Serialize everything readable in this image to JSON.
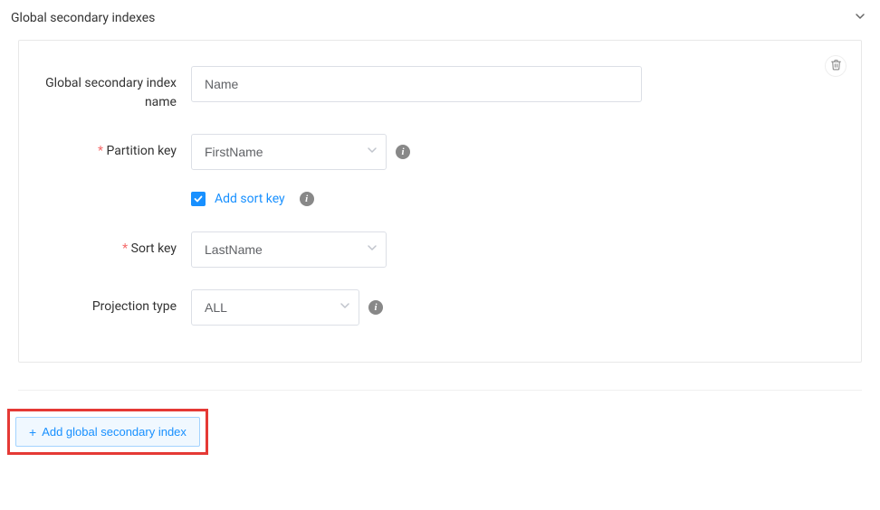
{
  "section": {
    "title": "Global secondary indexes"
  },
  "form": {
    "index_name": {
      "label": "Global secondary index name",
      "value": "Name"
    },
    "partition_key": {
      "label": "Partition key",
      "value": "FirstName"
    },
    "add_sort_key": {
      "label": "Add sort key",
      "checked": true
    },
    "sort_key": {
      "label": "Sort key",
      "value": "LastName"
    },
    "projection_type": {
      "label": "Projection type",
      "value": "ALL"
    }
  },
  "actions": {
    "add_index": "Add global secondary index"
  }
}
